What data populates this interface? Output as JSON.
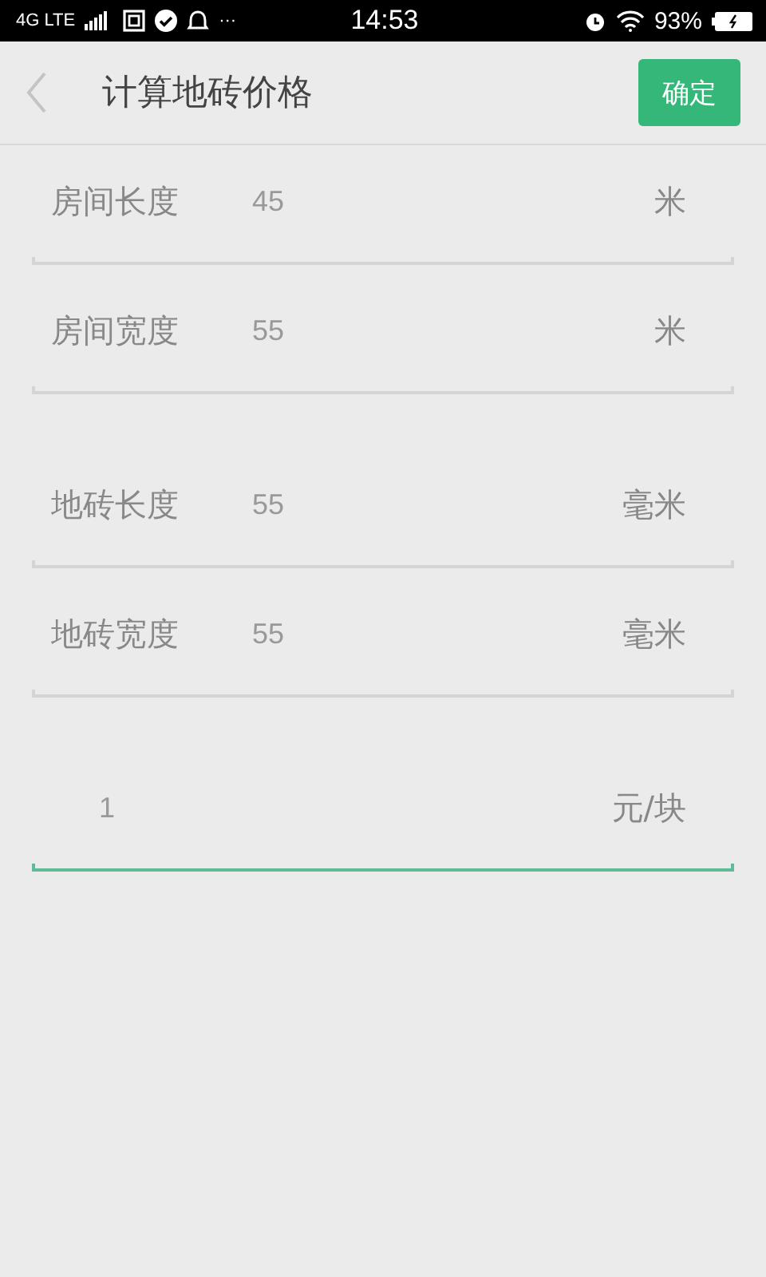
{
  "status_bar": {
    "network": "4G LTE",
    "more": "···",
    "time": "14:53",
    "battery": "93%"
  },
  "header": {
    "title": "计算地砖价格",
    "confirm": "确定"
  },
  "groups": [
    {
      "fields": [
        {
          "label": "房间长度",
          "value": "45",
          "unit": "米",
          "focused": false
        },
        {
          "label": "房间宽度",
          "value": "55",
          "unit": "米",
          "focused": false
        }
      ]
    },
    {
      "fields": [
        {
          "label": "地砖长度",
          "value": "55",
          "unit": "毫米",
          "focused": false
        },
        {
          "label": "地砖宽度",
          "value": "55",
          "unit": "毫米",
          "focused": false
        }
      ]
    },
    {
      "fields": [
        {
          "value": "1",
          "unit": "元/块",
          "focused": true
        }
      ]
    }
  ]
}
